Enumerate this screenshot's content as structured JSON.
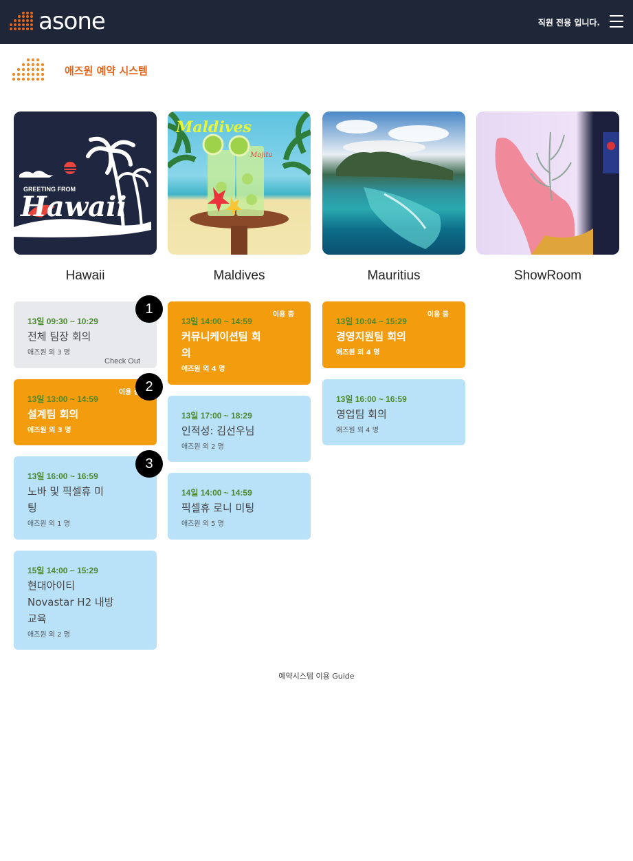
{
  "header": {
    "brand": "asone",
    "staff_note": "직원 전용 입니다.",
    "system_title": "애즈원 예약 시스템"
  },
  "rooms": [
    {
      "name": "Hawaii",
      "image_text_1": "GREETING FROM",
      "image_text_2": "Hawaii"
    },
    {
      "name": "Maldives",
      "image_text_1": "Maldives",
      "image_text_2": "Mojito"
    },
    {
      "name": "Mauritius"
    },
    {
      "name": "ShowRoom"
    }
  ],
  "bookings": {
    "hawaii": [
      {
        "time": "13일 09:30 ~ 10:29",
        "title": "전체 팀장 회의",
        "people": "애즈원 외 3 명",
        "checkout": "Check Out"
      },
      {
        "time": "13일 13:00 ~ 14:59",
        "title": "설계팀 회의",
        "people": "애즈원 외 3 명",
        "status": "이용 중"
      },
      {
        "time": "13일 16:00 ~ 16:59",
        "title_line1": "노바 및 픽셀휴 미",
        "title_line2": "팅",
        "people": "애즈원 외 1 명"
      },
      {
        "time": "15일 14:00 ~ 15:29",
        "title_line1": "현대아이티",
        "title_line2": "Novastar H2 내방",
        "title_line3": "교육",
        "people": "애즈원 외 2 명"
      }
    ],
    "maldives": [
      {
        "time": "13일 14:00 ~ 14:59",
        "title_line1": "커뮤니케이션팀 회",
        "title_line2": "의",
        "people": "애즈원 외 4 명",
        "status": "이용 중"
      },
      {
        "time": "13일 17:00 ~ 18:29",
        "title": "인적성: 김선우님",
        "people": "애즈원 외 2 명"
      },
      {
        "time": "14일 14:00 ~ 14:59",
        "title": "픽셀휴 로니 미팅",
        "people": "애즈원 외 5 명"
      }
    ],
    "mauritius": [
      {
        "time": "13일 10:04 ~ 15:29",
        "title": "경영지원팀 회의",
        "people": "애즈원 외 4 명",
        "status": "이용 중"
      },
      {
        "time": "13일 16:00 ~ 16:59",
        "title": "영업팀 회의",
        "people": "애즈원 외 4 명"
      }
    ]
  },
  "badges": [
    "1",
    "2",
    "3"
  ],
  "footer": {
    "guide_link": "예약시스템 이용 Guide"
  },
  "colors": {
    "topbar": "#1e2638",
    "accent_orange": "#e2671f",
    "active_card": "#f39c0e",
    "upcoming_card": "#b9e2f9",
    "past_card": "#e8e9ec",
    "time_green": "#4a8a2c"
  }
}
